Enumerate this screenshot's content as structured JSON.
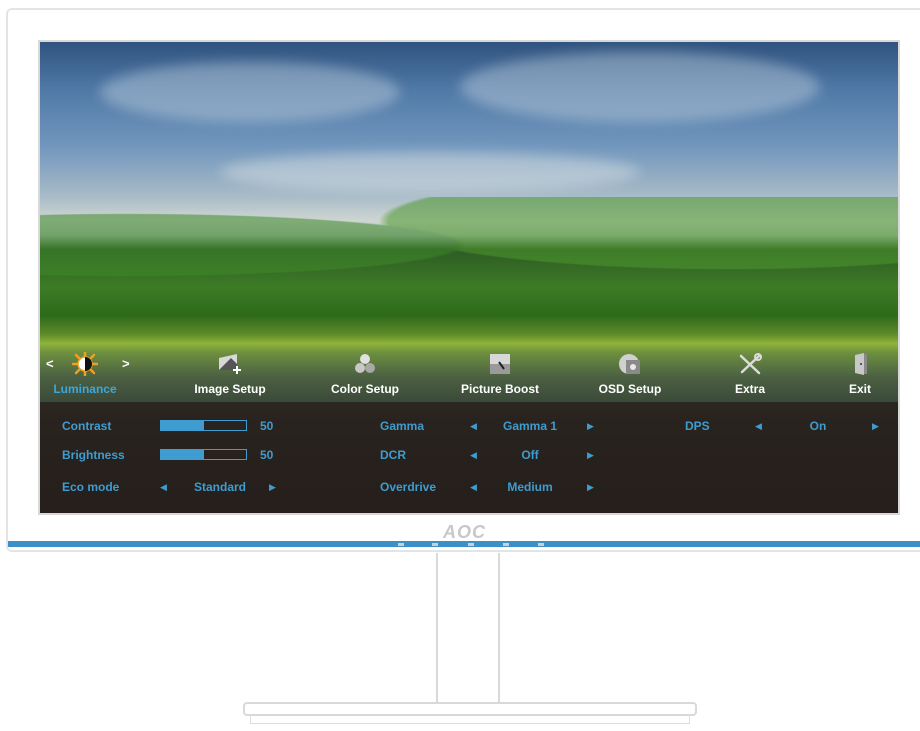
{
  "bezel": {
    "logo": "AOC"
  },
  "menu": {
    "items": [
      {
        "label": "Luminance",
        "icon": "sun-contrast-icon"
      },
      {
        "label": "Image Setup",
        "icon": "image-setup-icon"
      },
      {
        "label": "Color Setup",
        "icon": "color-setup-icon"
      },
      {
        "label": "Picture Boost",
        "icon": "picture-boost-icon"
      },
      {
        "label": "OSD Setup",
        "icon": "osd-setup-icon"
      },
      {
        "label": "Extra",
        "icon": "tools-icon"
      },
      {
        "label": "Exit",
        "icon": "exit-door-icon"
      }
    ],
    "active": "Luminance",
    "prev_arrow": "<",
    "next_arrow": ">"
  },
  "panel": {
    "contrast": {
      "label": "Contrast",
      "value": "50",
      "level": 0.5
    },
    "brightness": {
      "label": "Brightness",
      "value": "50",
      "level": 0.5
    },
    "eco_mode": {
      "label": "Eco mode",
      "value": "Standard"
    },
    "gamma": {
      "label": "Gamma",
      "value": "Gamma 1"
    },
    "dcr": {
      "label": "DCR",
      "value": "Off"
    },
    "overdrive": {
      "label": "Overdrive",
      "value": "Medium"
    },
    "dps": {
      "label": "DPS",
      "value": "On"
    }
  },
  "colors": {
    "accent": "#3e9cd0",
    "active_icon": "#f0a020",
    "panel_bg": "#2a1f19",
    "strip": "#3c8fc7"
  }
}
